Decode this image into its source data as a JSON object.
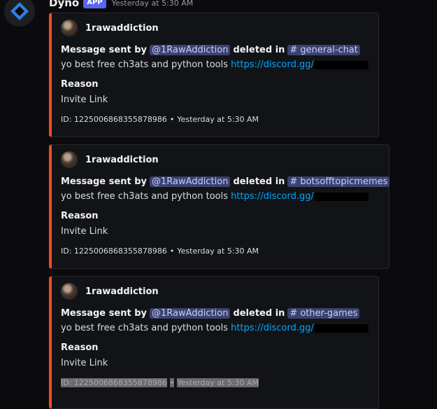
{
  "message": {
    "username": "Dyno",
    "app_tag": "APP",
    "timestamp": "Yesterday at 5:30 AM"
  },
  "embeds": [
    {
      "author": "1rawaddiction",
      "prefix": "Message sent by",
      "mention": "@1RawAddiction",
      "middle": "deleted in",
      "channel": "general-chat",
      "content": "yo best free ch3ats and python tools",
      "link": "https://discord.gg/",
      "reason_label": "Reason",
      "reason": "Invite Link",
      "footer_id": "ID: 1225006868355878986",
      "footer_time": "Yesterday at 5:30 AM"
    },
    {
      "author": "1rawaddiction",
      "prefix": "Message sent by",
      "mention": "@1RawAddiction",
      "middle": "deleted in",
      "channel": "botsofftopicmemes",
      "content": "yo best free ch3ats and python tools",
      "link": "https://discord.gg/",
      "reason_label": "Reason",
      "reason": "Invite Link",
      "footer_id": "ID: 1225006868355878986",
      "footer_time": "Yesterday at 5:30 AM"
    },
    {
      "author": "1rawaddiction",
      "prefix": "Message sent by",
      "mention": "@1RawAddiction",
      "middle": "deleted in",
      "channel": "other-games",
      "content": "yo best free ch3ats and python tools",
      "link": "https://discord.gg/",
      "reason_label": "Reason",
      "reason": "Invite Link",
      "footer_id": "ID: 1225006868355878986",
      "footer_time": "Yesterday at 5:30 AM"
    }
  ],
  "footer_separator": "•",
  "channel_icon": "#",
  "colors": {
    "background": "#0b0b0d",
    "embed_bar": "#f04c23",
    "app_tag": "#5865f2",
    "link": "#00a8fc",
    "mention_bg": "#3c4270"
  }
}
